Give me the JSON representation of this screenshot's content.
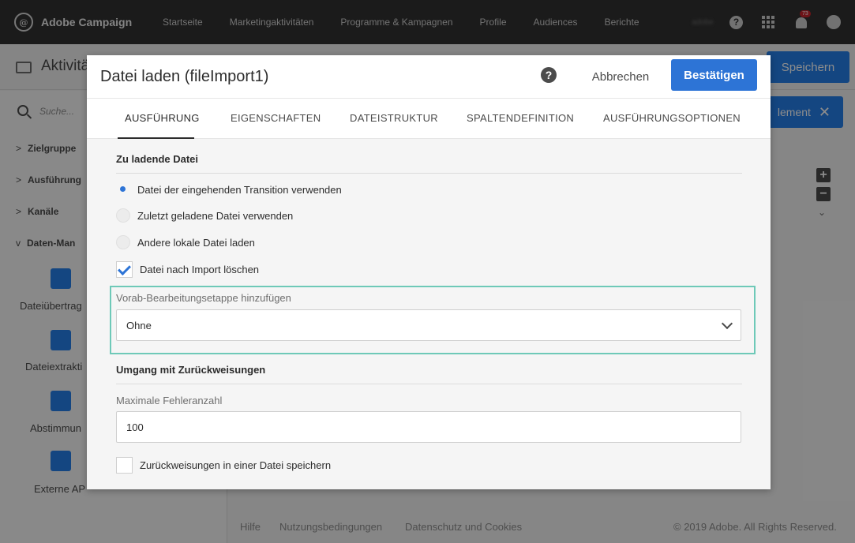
{
  "app": {
    "brand": "Adobe Campaign",
    "nav": [
      "Startseite",
      "Marketingaktivitäten",
      "Programme & Kampagnen",
      "Profile",
      "Audiences",
      "Berichte"
    ],
    "user": "adobe",
    "notification_count": "73"
  },
  "background": {
    "title": "Aktivitä",
    "save_label": "Speichern",
    "element_label": "lement",
    "search_placeholder": "Suche...",
    "groups": [
      "Zielgruppe",
      "Ausführung",
      "Kanäle",
      "Daten-Man"
    ],
    "tiles": [
      "Dateiübertrag",
      "Dateiextrakti",
      "Abstimmun",
      "Externe AP"
    ],
    "footer": {
      "links": [
        "Hilfe",
        "Nutzungsbedingungen",
        "Datenschutz und Cookies"
      ],
      "copyright": "© 2019 Adobe. All Rights Reserved."
    }
  },
  "modal": {
    "title": "Datei laden (fileImport1)",
    "cancel_label": "Abbrechen",
    "confirm_label": "Bestätigen",
    "tabs": [
      "AUSFÜHRUNG",
      "EIGENSCHAFTEN",
      "DATEISTRUKTUR",
      "SPALTENDEFINITION",
      "AUSFÜHRUNGSOPTIONEN"
    ],
    "active_tab": "AUSFÜHRUNG",
    "file_section": {
      "title": "Zu ladende Datei",
      "options": [
        {
          "label": "Datei der eingehenden Transition verwenden",
          "selected": true
        },
        {
          "label": "Zuletzt geladene Datei verwenden",
          "selected": false
        },
        {
          "label": "Andere lokale Datei laden",
          "selected": false
        }
      ],
      "delete_after_import": {
        "label": "Datei nach Import löschen",
        "checked": true
      },
      "preprocessing": {
        "label": "Vorab-Bearbeitungsetappe hinzufügen",
        "value": "Ohne"
      }
    },
    "reject_section": {
      "title": "Umgang mit Zurückweisungen",
      "max_errors": {
        "label": "Maximale Fehleranzahl",
        "value": "100"
      },
      "save_rejects": {
        "label": "Zurückweisungen in einer Datei speichern",
        "checked": false
      }
    }
  },
  "colors": {
    "accent": "#2d74d6",
    "focus": "#6ec9b8",
    "topbar": "#323232"
  }
}
